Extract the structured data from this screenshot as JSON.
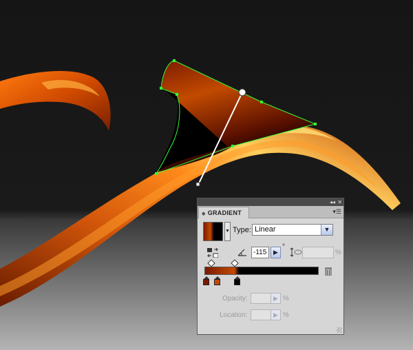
{
  "panel": {
    "collapse_icon": "double-chevron-icon",
    "close_icon": "close-icon",
    "tab_label": "GRADIENT",
    "menu_icon": "panel-menu-icon",
    "type_label": "Type:",
    "type_value": "Linear",
    "angle_value": "-115",
    "degree_symbol": "°",
    "aspect_ratio_value": "",
    "aspect_ratio_unit": "%",
    "opacity_label": "Opacity:",
    "opacity_value": "",
    "opacity_unit": "%",
    "location_label": "Location:",
    "location_value": "",
    "location_unit": "%",
    "gradient_stops": [
      {
        "color": "#7a1a00",
        "fraction": 0.0
      },
      {
        "color": "#c24a00",
        "fraction": 0.1
      },
      {
        "color": "#000000",
        "fraction": 0.28
      }
    ],
    "midpoints": [
      0.05,
      0.25
    ]
  },
  "canvas": {
    "background_color": "#151515",
    "floor_top_color": "#3a3a3a",
    "floor_bottom_color": "#b4b4b4",
    "selection_color": "#33ff33",
    "ribbon_colors": [
      "#5a1800",
      "#c84a00",
      "#ff7a00",
      "#ffcc55"
    ]
  }
}
